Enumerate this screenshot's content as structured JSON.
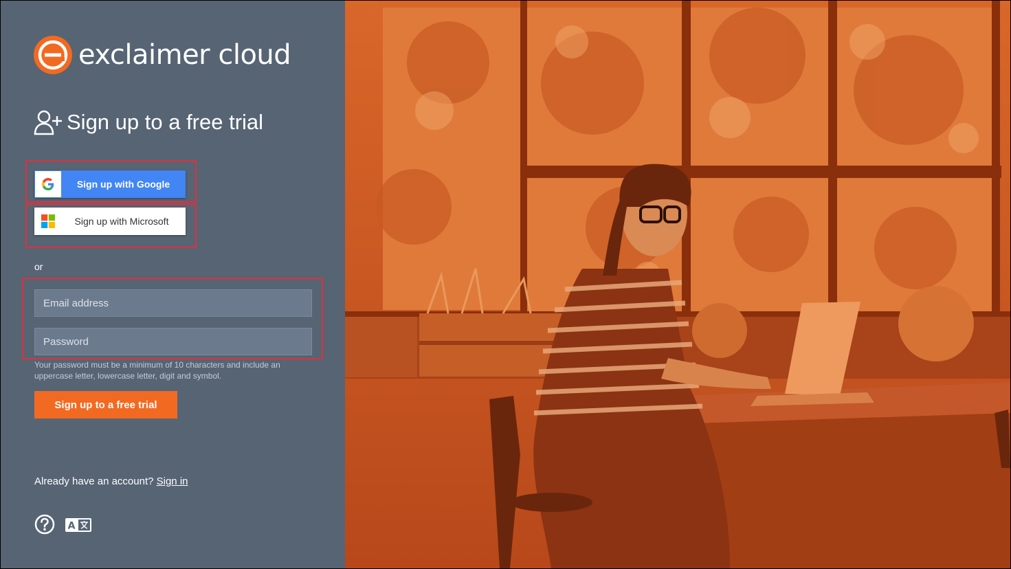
{
  "brand": {
    "name": "exclaimer cloud",
    "logo_icon": "exclaimer-logo-icon",
    "accent_color": "#f26a21"
  },
  "heading": {
    "icon": "add-user-icon",
    "text": "Sign up to a free trial"
  },
  "social": {
    "google_label": "Sign up with Google",
    "google_icon": "google-icon",
    "microsoft_label": "Sign up with Microsoft",
    "microsoft_icon": "microsoft-icon"
  },
  "divider_text": "or",
  "form": {
    "email_placeholder": "Email address",
    "email_value": "",
    "password_placeholder": "Password",
    "password_value": "",
    "password_hint": "Your password must be a minimum of 10 characters and include an uppercase letter, lowercase letter, digit and symbol.",
    "submit_label": "Sign up to a free trial"
  },
  "footer": {
    "account_prompt": "Already have an account?",
    "signin_link": "Sign in",
    "help_icon": "help-icon",
    "language_icon": "language-icon"
  },
  "colors": {
    "panel_bg": "#566474",
    "field_bg": "#6c7a8d",
    "google_blue": "#4285f4",
    "highlight_red": "#e0303a",
    "photo_tint": "#c8541a"
  }
}
